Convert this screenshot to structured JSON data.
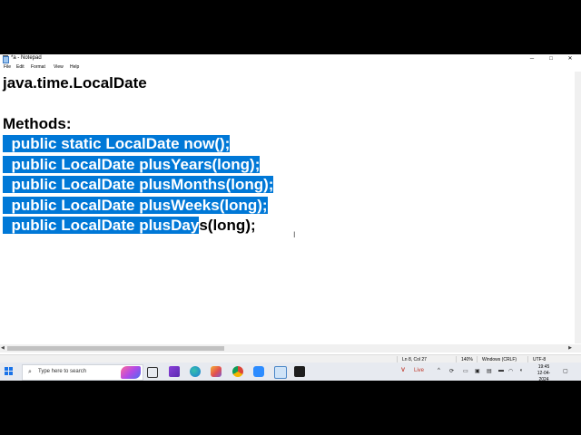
{
  "window": {
    "title": "*a - Notepad",
    "minimize": "─",
    "maximize": "□",
    "close": "✕"
  },
  "menu": [
    "File",
    "Edit",
    "Format",
    "View",
    "Help"
  ],
  "editor": {
    "lines": [
      {
        "selected": "",
        "rest": "java.time.LocalDate"
      },
      {
        "selected": "",
        "rest": ""
      },
      {
        "selected": "",
        "rest": "Methods:"
      },
      {
        "selected": "  public static LocalDate now();",
        "rest": ""
      },
      {
        "selected": "  public LocalDate plusYears(long);",
        "rest": ""
      },
      {
        "selected": "  public LocalDate plusMonths(long);",
        "rest": ""
      },
      {
        "selected": "  public LocalDate plusWeeks(long);",
        "rest": ""
      },
      {
        "selected": "  public LocalDate plusDay",
        "rest": "s(long);"
      }
    ],
    "selection_color": "#0078d7"
  },
  "statusbar": {
    "position": "Ln 8, Col 27",
    "zoom": "140%",
    "line_ending": "Windows (CRLF)",
    "encoding": "UTF-8"
  },
  "taskbar": {
    "search_placeholder": "Type here to search",
    "live_label": "Live",
    "time": "19:45",
    "date": "12-04-2024",
    "pinned_icons": [
      "task-view-icon",
      "visual-studio-icon",
      "edge-icon",
      "paint-icon",
      "chrome-icon",
      "zoom-icon",
      "notepad-icon",
      "terminal-icon"
    ]
  }
}
